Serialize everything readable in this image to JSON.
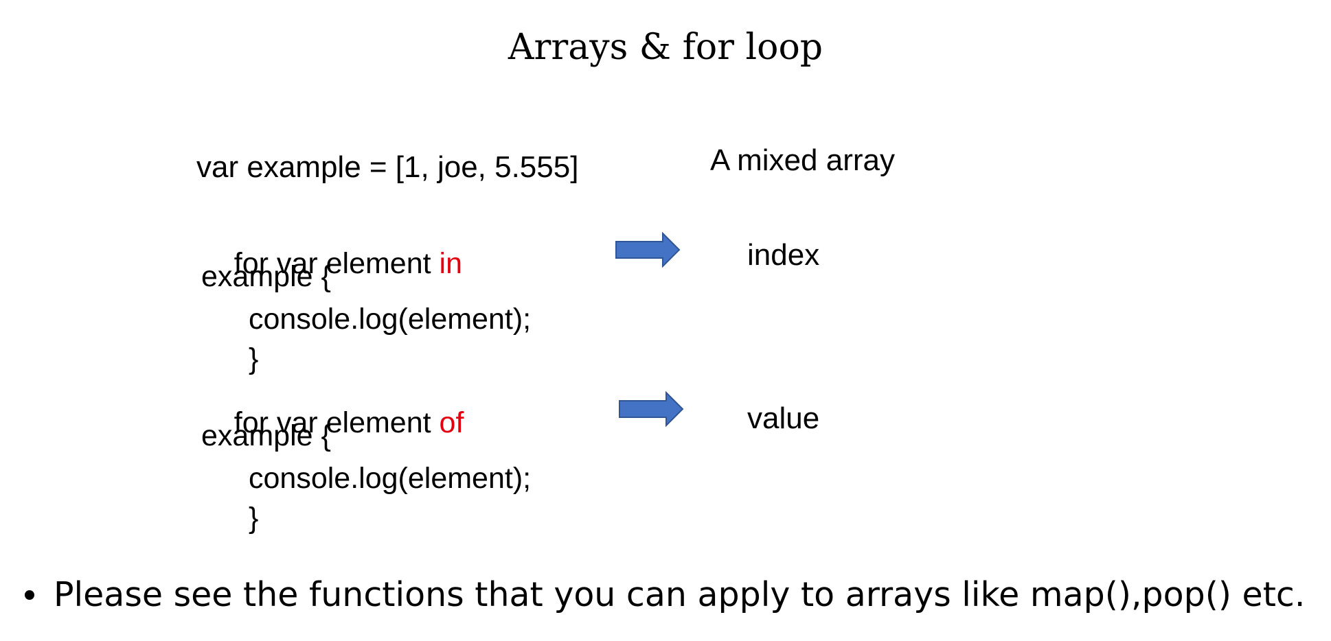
{
  "slide": {
    "title": "Arrays & for loop",
    "declaration": "var example = [1, joe, 5.555]",
    "declaration_note": "A mixed array",
    "loops": [
      {
        "line1_prefix": "for var element ",
        "keyword": "in",
        "line2": "example {",
        "line3": "console.log(element);",
        "line4": "}",
        "result": "index"
      },
      {
        "line1_prefix": "for var element ",
        "keyword": "of",
        "line2": "example {",
        "line3": "console.log(element);",
        "line4": "}",
        "result": "value"
      }
    ],
    "bullet": "Please see the functions that you can apply to arrays like map(),pop() etc."
  },
  "colors": {
    "keyword": "#e3000f",
    "arrow_fill": "#4472c4",
    "arrow_stroke": "#2f5597"
  },
  "icons": {
    "loop_arrow": "right-arrow-icon"
  }
}
